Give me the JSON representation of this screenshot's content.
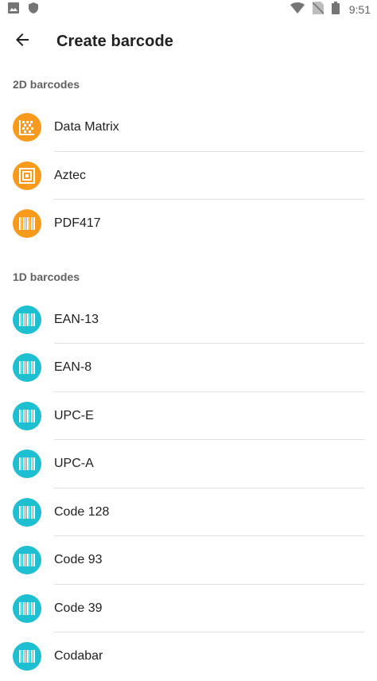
{
  "status_bar": {
    "time": "9:51",
    "icons_left": [
      "image-icon",
      "shield-icon"
    ],
    "icons_right": [
      "wifi-icon",
      "no-sim-icon",
      "battery-icon"
    ]
  },
  "app_bar": {
    "title": "Create barcode",
    "back_icon": "arrow-back-icon"
  },
  "sections": [
    {
      "header": "2D barcodes",
      "color": "#f89a1c",
      "items": [
        {
          "label": "Data Matrix",
          "icon": "data-matrix-icon"
        },
        {
          "label": "Aztec",
          "icon": "aztec-icon"
        },
        {
          "label": "PDF417",
          "icon": "barcode-icon"
        }
      ]
    },
    {
      "header": "1D barcodes",
      "color": "#1ebfd0",
      "items": [
        {
          "label": "EAN-13",
          "icon": "barcode-icon"
        },
        {
          "label": "EAN-8",
          "icon": "barcode-icon"
        },
        {
          "label": "UPC-E",
          "icon": "barcode-icon"
        },
        {
          "label": "UPC-A",
          "icon": "barcode-icon"
        },
        {
          "label": "Code 128",
          "icon": "barcode-icon"
        },
        {
          "label": "Code 93",
          "icon": "barcode-icon"
        },
        {
          "label": "Code 39",
          "icon": "barcode-icon"
        },
        {
          "label": "Codabar",
          "icon": "barcode-icon"
        }
      ]
    }
  ]
}
